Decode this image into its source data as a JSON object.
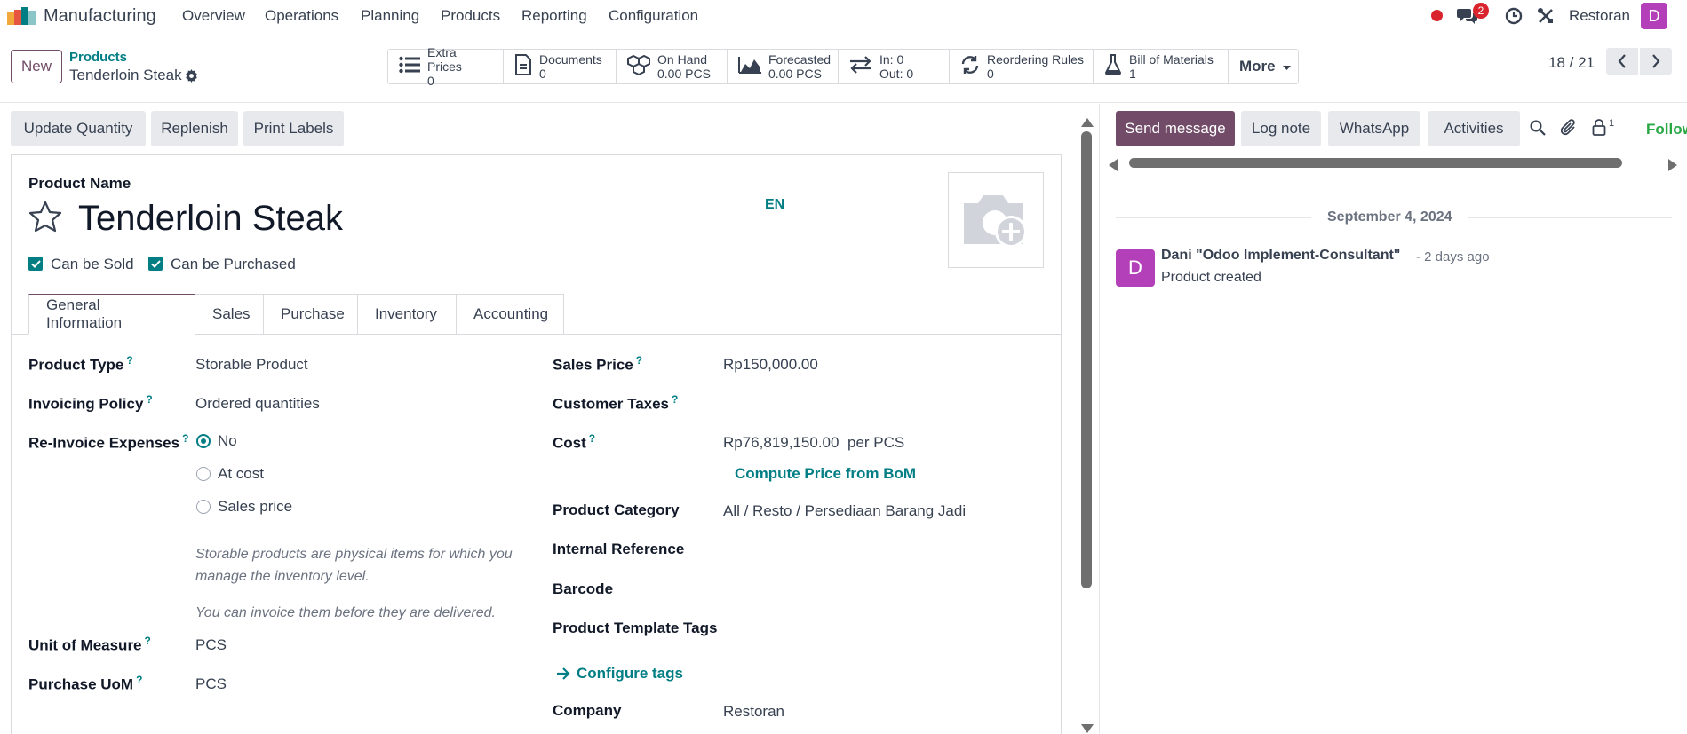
{
  "nav": {
    "app_name": "Manufacturing",
    "menus": [
      "Overview",
      "Operations",
      "Planning",
      "Products",
      "Reporting",
      "Configuration"
    ],
    "message_count": "2",
    "company": "Restoran",
    "avatar_letter": "D",
    "avatar_color": "#b340b8"
  },
  "control": {
    "new_label": "New",
    "breadcrumb_parent": "Products",
    "breadcrumb_current": "Tenderloin Steak",
    "pager": "18 / 21",
    "more_label": "More",
    "smart_buttons": [
      {
        "label": "Extra Prices",
        "value": "0",
        "icon": "list-icon"
      },
      {
        "label": "Documents",
        "value": "0",
        "icon": "document-icon"
      },
      {
        "label": "On Hand",
        "value": "0.00 PCS",
        "icon": "cubes-icon"
      },
      {
        "label": "Forecasted",
        "value": "0.00 PCS",
        "icon": "area-chart-icon"
      },
      {
        "label": "In: 0",
        "value": "Out: 0",
        "icon": "exchange-icon"
      },
      {
        "label": "Reordering Rules",
        "value": "0",
        "icon": "refresh-icon"
      },
      {
        "label": "Bill of Materials",
        "value": "1",
        "icon": "flask-icon"
      }
    ]
  },
  "actions": {
    "update_quantity": "Update Quantity",
    "replenish": "Replenish",
    "print_labels": "Print Labels"
  },
  "form": {
    "product_name_label": "Product Name",
    "product_name": "Tenderloin Steak",
    "lang": "EN",
    "can_be_sold": "Can be Sold",
    "can_be_purchased": "Can be Purchased",
    "tabs": [
      "General Information",
      "Sales",
      "Purchase",
      "Inventory",
      "Accounting"
    ],
    "product_type_label": "Product Type",
    "product_type": "Storable Product",
    "invoicing_policy_label": "Invoicing Policy",
    "invoicing_policy": "Ordered quantities",
    "reinvoice_label": "Re-Invoice Expenses",
    "reinvoice_options": [
      "No",
      "At cost",
      "Sales price"
    ],
    "help_1": "Storable products are physical items for which you manage the inventory level.",
    "help_2": "You can invoice them before they are delivered.",
    "uom_label": "Unit of Measure",
    "uom": "PCS",
    "purchase_uom_label": "Purchase UoM",
    "purchase_uom": "PCS",
    "sales_price_label": "Sales Price",
    "sales_price": "Rp150,000.00",
    "customer_taxes_label": "Customer Taxes",
    "cost_label": "Cost",
    "cost": "Rp76,819,150.00",
    "cost_unit": "per PCS",
    "compute_bom": "Compute Price from BoM",
    "category_label": "Product Category",
    "category": "All / Resto / Persediaan Barang Jadi",
    "internal_ref_label": "Internal Reference",
    "barcode_label": "Barcode",
    "tags_label": "Product Template Tags",
    "configure_tags": "Configure tags",
    "company_label": "Company",
    "company": "Restoran"
  },
  "chatter": {
    "send_message": "Send message",
    "log_note": "Log note",
    "whatsapp": "WhatsApp",
    "activities": "Activities",
    "follower_count": "1",
    "follow": "Follow",
    "date_separator": "September 4, 2024",
    "author": "Dani \"Odoo Implement-Consultant\"",
    "time": "- 2 days ago",
    "body": "Product created",
    "author_initial": "D"
  },
  "colors": {
    "brand": "#714b67",
    "teal": "#017e84",
    "badge_red": "#d9232d"
  }
}
